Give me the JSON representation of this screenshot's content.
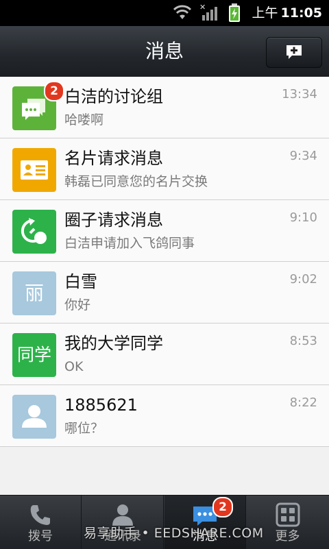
{
  "status_bar": {
    "time_prefix": "上午",
    "time": "11:05"
  },
  "header": {
    "title": "消息"
  },
  "conversations": [
    {
      "name": "白洁的讨论组",
      "preview": "哈喽啊",
      "time": "13:34",
      "badge": "2",
      "avatar": "group-chat-icon",
      "color": "#5db33a"
    },
    {
      "name": "名片请求消息",
      "preview": "韩磊已同意您的名片交换",
      "time": "9:34",
      "avatar": "business-card-icon",
      "color": "#f0a800"
    },
    {
      "name": "圈子请求消息",
      "preview": "白洁申请加入飞鸽同事",
      "time": "9:10",
      "avatar": "circle-request-icon",
      "color": "#2db24a"
    },
    {
      "name": "白雪",
      "preview": "你好",
      "time": "9:02",
      "avatar_text": "丽",
      "color": "#a7c8dd"
    },
    {
      "name": "我的大学同学",
      "preview": "OK",
      "time": "8:53",
      "avatar_text": "同学",
      "color": "#2db24a"
    },
    {
      "name": "1885621",
      "preview": "哪位？",
      "time": "8:22",
      "avatar": "person-icon",
      "color": "#a7c8dd"
    }
  ],
  "tabs": [
    {
      "label": "拨号",
      "icon": "phone-icon"
    },
    {
      "label": "通讯录",
      "icon": "contacts-icon"
    },
    {
      "label": "消息",
      "icon": "messages-icon",
      "badge": "2",
      "active": true
    },
    {
      "label": "更多",
      "icon": "more-grid-icon"
    }
  ],
  "watermark": "易享助手 • EEDSHARE.COM"
}
